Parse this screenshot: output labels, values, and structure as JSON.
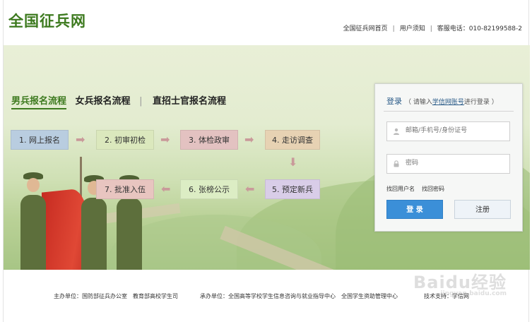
{
  "header": {
    "logo": "全国征兵网",
    "links": [
      "全国征兵网首页",
      "用户须知",
      "客服电话：010-82199588-2"
    ]
  },
  "tabs": [
    {
      "label": "男兵报名流程",
      "active": true
    },
    {
      "label": "女兵报名流程",
      "active": false
    },
    {
      "label": "直招士官报名流程",
      "active": false
    }
  ],
  "steps": [
    "1. 网上报名",
    "2. 初审初检",
    "3. 体检政审",
    "4. 走访调查",
    "5. 预定新兵",
    "6. 张榜公示",
    "7. 批准入伍"
  ],
  "login": {
    "title": "登录",
    "hint_prefix": "（ 请输入",
    "hint_link": "学信网账号",
    "hint_suffix": "进行登录 ）",
    "username_placeholder": "邮箱/手机号/身份证号",
    "password_placeholder": "密码",
    "forgot_username": "找回用户名",
    "forgot_password": "找回密码",
    "login_button": "登 录",
    "register_button": "注册"
  },
  "footer": {
    "sponsor": "主办单位：国防部征兵办公室　教育部高校学生司",
    "organizer": "承办单位：全国高等学校学生信息咨询与就业指导中心　全国学生资助管理中心",
    "tech": "技术支持：学信网"
  },
  "watermark": {
    "main": "Baidu经验",
    "sub": "jingyan.baidu.com"
  },
  "colors": {
    "brand_green": "#3d7a1f",
    "login_blue": "#3b8fd8"
  }
}
